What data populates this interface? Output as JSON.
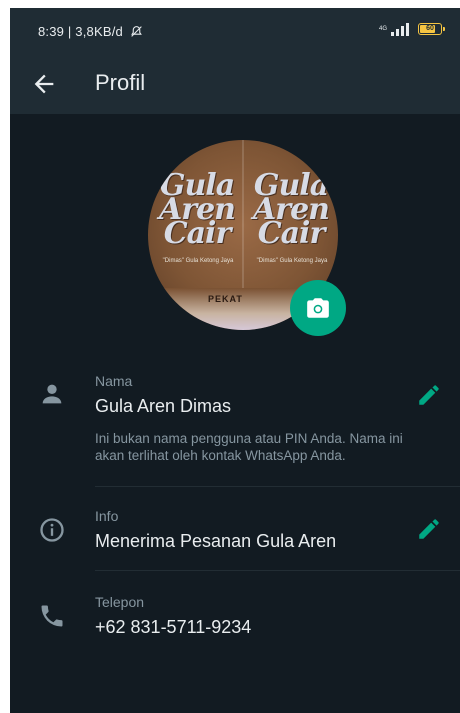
{
  "status_bar": {
    "time_text": "8:39 | 3,8KB/d",
    "network": "4G",
    "battery_text": "60"
  },
  "app_bar": {
    "title": "Profil"
  },
  "avatar": {
    "logo_left": "Gula Aren Cair",
    "logo_right": "Gula Aren Cair",
    "tagline_left": "\"Dimas\" Gula Ketong Jaya",
    "tagline_right": "\"Dimas\" Gula Ketong Jaya",
    "band_label": "PEKAT"
  },
  "name_row": {
    "label": "Nama",
    "value": "Gula Aren Dimas",
    "hint": "Ini bukan nama pengguna atau PIN Anda. Nama ini akan terlihat oleh kontak WhatsApp Anda."
  },
  "about_row": {
    "label": "Info",
    "value": "Menerima Pesanan Gula Aren"
  },
  "phone_row": {
    "label": "Telepon",
    "value": "+62 831-5711-9234"
  },
  "colors": {
    "background": "#121b22",
    "header": "#1f2c34",
    "accent": "#00a884",
    "primary_text": "#e9edef",
    "secondary_text": "#8696a0"
  },
  "icons": {
    "back": "arrow-left-icon",
    "camera": "camera-icon",
    "name": "person-icon",
    "about": "info-icon",
    "phone": "phone-icon",
    "edit": "pencil-icon"
  }
}
